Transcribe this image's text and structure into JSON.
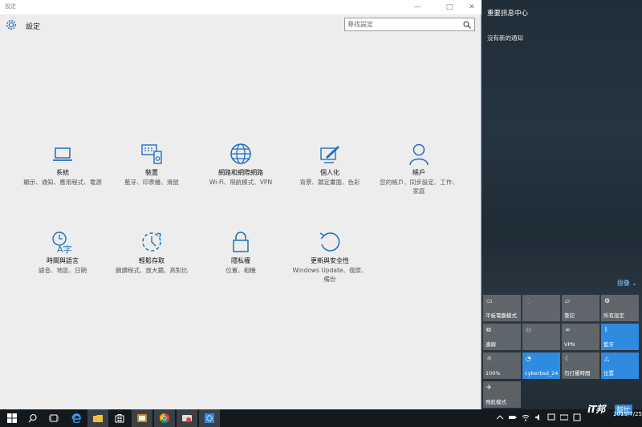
{
  "window": {
    "title": "設定",
    "minimize": "—",
    "maximize": "□",
    "close": "✕"
  },
  "header": {
    "title": "設定",
    "search_placeholder": "尋找設定"
  },
  "tiles": [
    {
      "label": "系統",
      "desc": "顯示、通知、應用程式、電源",
      "icon": "laptop-icon"
    },
    {
      "label": "裝置",
      "desc": "藍牙、印表機、滑鼠",
      "icon": "devices-icon"
    },
    {
      "label": "網路和網際網路",
      "desc": "Wi-Fi、飛航模式、VPN",
      "icon": "globe-icon"
    },
    {
      "label": "個人化",
      "desc": "背景、鎖定畫面、色彩",
      "icon": "paint-icon"
    },
    {
      "label": "帳戶",
      "desc": "您的帳戶、同步設定、工作、家庭",
      "icon": "person-icon"
    },
    {
      "label": "時間與語言",
      "desc": "語音、地區、日期",
      "icon": "time-language-icon"
    },
    {
      "label": "輕鬆存取",
      "desc": "朗讀程式、放大鏡、高對比",
      "icon": "ease-of-access-icon"
    },
    {
      "label": "隱私權",
      "desc": "位置、相機",
      "icon": "lock-icon"
    },
    {
      "label": "更新與安全性",
      "desc": "Windows Update、復原、備份",
      "icon": "update-icon"
    }
  ],
  "action_center": {
    "title": "重要訊息中心",
    "no_notifications": "沒有新的通知",
    "collapse": "摺疊",
    "quick_actions": [
      {
        "label": "平板電腦模式",
        "state": "off"
      },
      {
        "label": "",
        "state": "dim"
      },
      {
        "label": "筆記",
        "state": "off"
      },
      {
        "label": "所有設定",
        "state": "off"
      },
      {
        "label": "連線",
        "state": "off"
      },
      {
        "label": "",
        "state": "dim"
      },
      {
        "label": "VPN",
        "state": "off"
      },
      {
        "label": "藍牙",
        "state": "on"
      },
      {
        "label": "100%",
        "state": "off"
      },
      {
        "label": "cyberbsd_24",
        "state": "on"
      },
      {
        "label": "勿打擾時間",
        "state": "off"
      },
      {
        "label": "位置",
        "state": "on"
      },
      {
        "label": "飛航模式",
        "state": "off"
      }
    ]
  },
  "taskbar": {
    "clock_date": "2015/7/25"
  },
  "watermark": {
    "text": "iT邦",
    "badge": "幫忙"
  },
  "colors": {
    "accent": "#2e8be0",
    "icon": "#1e6fc0"
  }
}
